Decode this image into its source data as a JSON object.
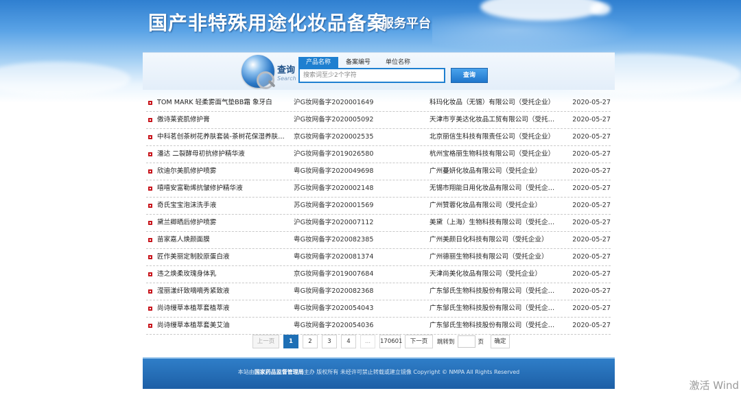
{
  "header": {
    "title": "国产非特殊用途化妆品备案",
    "subtitle": "服务平台"
  },
  "search": {
    "caption": "查询",
    "caption_en": "Search",
    "tabs": [
      "产品名称",
      "备案编号",
      "单位名称"
    ],
    "active_tab": "产品名称",
    "placeholder": "搜索词至少2个字符",
    "button_label": "查询"
  },
  "records": [
    {
      "name": "TOM MARK 轻柔雾面气垫BB霜 象牙白",
      "number": "沪G妆网备字2020001649",
      "company": "科玛化妆品（无锡）有限公司（受托企业）",
      "date": "2020-05-27"
    },
    {
      "name": "傲诗莱瓷肌修护膏",
      "number": "沪G妆网备字2020005092",
      "company": "天津市亨美达化妆品工贸有限公司（受托…",
      "date": "2020-05-27"
    },
    {
      "name": "中科茗创茶树花养肤套装-茶树花保湿养肤…",
      "number": "京G妆网备字2020002535",
      "company": "北京丽信生科技有限责任公司（受托企业）",
      "date": "2020-05-27"
    },
    {
      "name": "潘达 二裂酵母初抗修护精华液",
      "number": "沪G妆网备字2019026580",
      "company": "杭州宝格丽生物科技有限公司（受托企业）",
      "date": "2020-05-27"
    },
    {
      "name": "欣迪尔美肌修护喷雾",
      "number": "粤G妆网备字2020049698",
      "company": "广州蔓妍化妆品有限公司（受托企业）",
      "date": "2020-05-27"
    },
    {
      "name": "嘻嘻安富勒烯抗皱修护精华液",
      "number": "苏G妆网备字2020002148",
      "company": "无锡市翔能日用化妆品有限公司（受托企…",
      "date": "2020-05-27"
    },
    {
      "name": "奇氏宝宝泡沫洗手液",
      "number": "苏G妆网备字2020001569",
      "company": "广州赞蓉化妆品有限公司（受托企业）",
      "date": "2020-05-27"
    },
    {
      "name": "黛兰卿晒后修护喷雾",
      "number": "沪G妆网备字2020007112",
      "company": "美黛（上海）生物科技有限公司（受托企…",
      "date": "2020-05-27"
    },
    {
      "name": "苗家嘉人焕颜面膜",
      "number": "粤G妆网备字2020082385",
      "company": "广州美颜日化科技有限公司（受托企业）",
      "date": "2020-05-27"
    },
    {
      "name": "匠作美丽定制胶原蛋白液",
      "number": "粤G妆网备字2020081374",
      "company": "广州德丽生物科技有限公司（受托企业）",
      "date": "2020-05-27"
    },
    {
      "name": "违之焕柔玫瑰身体乳",
      "number": "京G妆网备字2019007684",
      "company": "天津尚美化妆品有限公司（受托企业）",
      "date": "2020-05-27"
    },
    {
      "name": "滢丽漾纤致嘀嘀秀紧致液",
      "number": "粤G妆网备字2020082368",
      "company": "广东邹氏生物科技股份有限公司（受托企…",
      "date": "2020-05-27"
    },
    {
      "name": "尚诗缦草本植萃套植萃液",
      "number": "粤G妆网备字2020054043",
      "company": "广东邹氏生物科技股份有限公司（受托企…",
      "date": "2020-05-27"
    },
    {
      "name": "尚诗缦草本植萃套美艾油",
      "number": "粤G妆网备字2020054036",
      "company": "广东邹氏生物科技股份有限公司（受托企…",
      "date": "2020-05-27"
    }
  ],
  "pagination": {
    "prev": "上一页",
    "current": "1",
    "pages": [
      "2",
      "3",
      "4"
    ],
    "ellipsis": "...",
    "last": "170601",
    "next": "下一页",
    "jump_label": "跳转到",
    "page_unit": "页",
    "go": "确定"
  },
  "footer": {
    "prefix": "本站由",
    "org": "国家药品监督管理局",
    "suffix": "主办 版权所有 未经许可禁止转载或建立镜像 Copyright © NMPA All Rights Reserved"
  },
  "watermark": "激活 Wind"
}
